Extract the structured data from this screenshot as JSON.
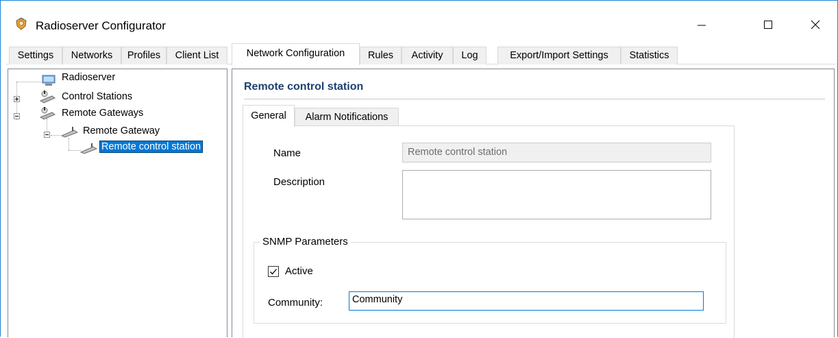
{
  "window": {
    "title": "Radioserver Configurator",
    "accent_color": "#1883d7",
    "icon": "radioserver-app-icon"
  },
  "tabs": [
    {
      "label": "Settings",
      "active": false
    },
    {
      "label": "Networks",
      "active": false
    },
    {
      "label": "Profiles",
      "active": false
    },
    {
      "label": "Client List",
      "active": false
    },
    {
      "label": "Network Configuration",
      "active": true
    },
    {
      "label": "Rules",
      "active": false
    },
    {
      "label": "Activity",
      "active": false
    },
    {
      "label": "Log",
      "active": false
    },
    {
      "label": "Export/Import Settings",
      "active": false
    },
    {
      "label": "Statistics",
      "active": false
    }
  ],
  "tree": {
    "root": "Radioserver",
    "control_stations": "Control Stations",
    "remote_gateways": "Remote Gateways",
    "remote_gateway": "Remote Gateway",
    "remote_control_station": "Remote control station",
    "selected_color": "#0078d7"
  },
  "content": {
    "title": "Remote control station",
    "title_color": "#1e3f6e",
    "subtabs": [
      {
        "label": "General",
        "active": true
      },
      {
        "label": "Alarm Notifications",
        "active": false
      }
    ],
    "form": {
      "name_label": "Name",
      "name_value": "Remote control station",
      "description_label": "Description",
      "description_value": "",
      "snmp": {
        "group_title": "SNMP Parameters",
        "active_label": "Active",
        "active_checked": true,
        "community_label": "Community:",
        "community_value": "Community"
      }
    }
  }
}
